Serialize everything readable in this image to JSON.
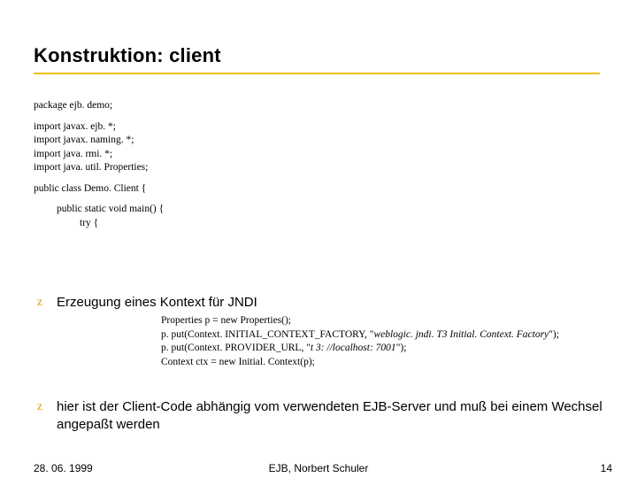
{
  "title": "Konstruktion: client",
  "code": {
    "l1": "package ejb. demo;",
    "l2": "import javax. ejb. *;",
    "l3": "import javax. naming. *;",
    "l4": "import java. rmi. *;",
    "l5": "import java. util. Properties;",
    "l6": "public class Demo. Client {",
    "l7": "public static void main() {",
    "l8": "try {"
  },
  "bullet1": "Erzeugung eines Kontext für JNDI",
  "sub": {
    "s1a": "Properties p = new Properties();",
    "s2a": "p. put(Context. INITIAL_CONTEXT_FACTORY, \"",
    "s2b": "weblogic. jndi. T3 Initial. Context. Factory",
    "s2c": "\");",
    "s3a": "p. put(Context. PROVIDER_URL, \"",
    "s3b": "t 3: //localhost: 7001",
    "s3c": "\");",
    "s4a": "Context ctx = new Initial. Context(p);"
  },
  "bullet2": "hier ist der Client-Code abhängig vom verwendeten EJB-Server und muß bei einem Wechsel angepaßt werden",
  "footer": {
    "date": "28. 06. 1999",
    "center": "EJB, Norbert Schuler",
    "page": "14"
  },
  "glyph": "z"
}
